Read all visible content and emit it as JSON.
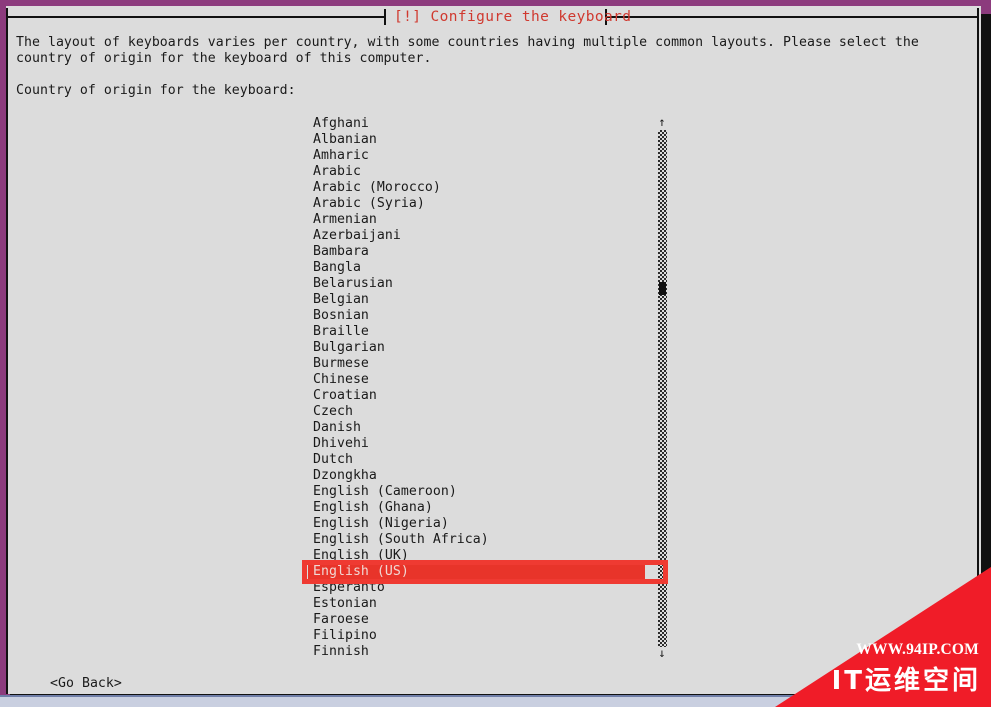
{
  "window": {
    "title": "[!] Configure the keyboard",
    "title_color": "#d0392f",
    "background_color": "#8c3b7d",
    "dialog_color": "#dcdcdc"
  },
  "description": {
    "line1": "The layout of keyboards varies per country, with some countries having multiple common layouts. Please select the",
    "line2": "country of origin for the keyboard of this computer.",
    "prompt": "Country of origin for the keyboard:"
  },
  "list": {
    "selected_value": "English (US)",
    "selection_color": "#e8342a",
    "annotation_color": "#ef3a32",
    "items": [
      {
        "label": "Afghani",
        "selected": false
      },
      {
        "label": "Albanian",
        "selected": false
      },
      {
        "label": "Amharic",
        "selected": false
      },
      {
        "label": "Arabic",
        "selected": false
      },
      {
        "label": "Arabic (Morocco)",
        "selected": false
      },
      {
        "label": "Arabic (Syria)",
        "selected": false
      },
      {
        "label": "Armenian",
        "selected": false
      },
      {
        "label": "Azerbaijani",
        "selected": false
      },
      {
        "label": "Bambara",
        "selected": false
      },
      {
        "label": "Bangla",
        "selected": false
      },
      {
        "label": "Belarusian",
        "selected": false
      },
      {
        "label": "Belgian",
        "selected": false
      },
      {
        "label": "Bosnian",
        "selected": false
      },
      {
        "label": "Braille",
        "selected": false
      },
      {
        "label": "Bulgarian",
        "selected": false
      },
      {
        "label": "Burmese",
        "selected": false
      },
      {
        "label": "Chinese",
        "selected": false
      },
      {
        "label": "Croatian",
        "selected": false
      },
      {
        "label": "Czech",
        "selected": false
      },
      {
        "label": "Danish",
        "selected": false
      },
      {
        "label": "Dhivehi",
        "selected": false
      },
      {
        "label": "Dutch",
        "selected": false
      },
      {
        "label": "Dzongkha",
        "selected": false
      },
      {
        "label": "English (Cameroon)",
        "selected": false
      },
      {
        "label": "English (Ghana)",
        "selected": false
      },
      {
        "label": "English (Nigeria)",
        "selected": false
      },
      {
        "label": "English (South Africa)",
        "selected": false
      },
      {
        "label": "English (UK)",
        "selected": false
      },
      {
        "label": "English (US)",
        "selected": true
      },
      {
        "label": "Esperanto",
        "selected": false
      },
      {
        "label": "Estonian",
        "selected": false
      },
      {
        "label": "Faroese",
        "selected": false
      },
      {
        "label": "Filipino",
        "selected": false
      },
      {
        "label": "Finnish",
        "selected": false
      }
    ]
  },
  "scrollbar": {
    "up_arrow": "↑",
    "down_arrow": "↓"
  },
  "buttons": {
    "go_back": "<Go Back>"
  },
  "watermark": {
    "url": "WWW.94IP.COM",
    "title": "IT运维空间",
    "color": "#f01c28"
  }
}
